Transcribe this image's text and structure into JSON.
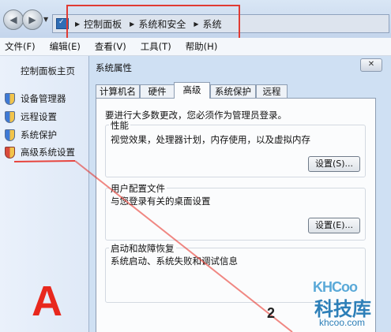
{
  "breadcrumbs": [
    "控制面板",
    "系统和安全",
    "系统"
  ],
  "menubar": [
    {
      "label": "文件(F)"
    },
    {
      "label": "编辑(E)"
    },
    {
      "label": "查看(V)"
    },
    {
      "label": "工具(T)"
    },
    {
      "label": "帮助(H)"
    }
  ],
  "leftpane": {
    "home": "控制面板主页",
    "tasks": [
      {
        "label": "设备管理器",
        "icon": "shield-icon"
      },
      {
        "label": "远程设置",
        "icon": "shield-icon"
      },
      {
        "label": "系统保护",
        "icon": "shield-icon"
      },
      {
        "label": "高级系统设置",
        "icon": "shield-icon"
      }
    ]
  },
  "dialog": {
    "title": "系统属性",
    "close": "✕",
    "tabs": [
      "计算机名",
      "硬件",
      "高级",
      "系统保护",
      "远程"
    ],
    "active_tab": "高级",
    "admin_note": "要进行大多数更改，您必须作为管理员登录。",
    "performance": {
      "title": "性能",
      "desc": "视觉效果，处理器计划，内存使用，以及虚拟内存",
      "button": "设置(S)..."
    },
    "profiles": {
      "title": "用户配置文件",
      "desc": "与您登录有关的桌面设置",
      "button": "设置(E)..."
    },
    "startup": {
      "title": "启动和故障恢复",
      "desc": "系统启动、系统失败和调试信息"
    }
  },
  "annotations": {
    "letter": "A",
    "number": "2",
    "color": "#e8281e"
  },
  "watermark": {
    "logo": "KHCoo",
    "name": "科技库",
    "url": "khcoo.com"
  }
}
